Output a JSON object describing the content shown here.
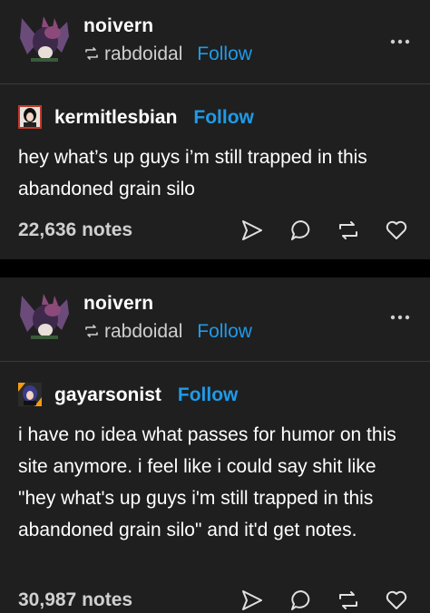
{
  "posts": [
    {
      "blog_name": "noivern",
      "reblogged_from": "rabdoidal",
      "follow_label": "Follow",
      "reblog_author": "kermitlesbian",
      "reblog_follow_label": "Follow",
      "text": "hey what’s up guys i’m still trapped in this abandoned grain silo",
      "notes": "22,636 notes"
    },
    {
      "blog_name": "noivern",
      "reblogged_from": "rabdoidal",
      "follow_label": "Follow",
      "reblog_author": "gayarsonist",
      "reblog_follow_label": "Follow",
      "text": "i have no idea what passes for humor on this site anymore. i feel like i could say shit like \"hey what's up guys i'm still trapped in this abandoned grain silo\" and it'd get notes.",
      "notes": "30,987 notes"
    }
  ],
  "icons": {
    "reblog_small": "reblog-icon",
    "more": "more-options-icon",
    "share": "share-icon",
    "reply": "reply-icon",
    "reblog": "reblog-icon",
    "like": "heart-icon"
  },
  "colors": {
    "background": "#000000",
    "post_background": "#1f1f1f",
    "link": "#1e9be9",
    "muted_text": "#cfcfcf"
  }
}
